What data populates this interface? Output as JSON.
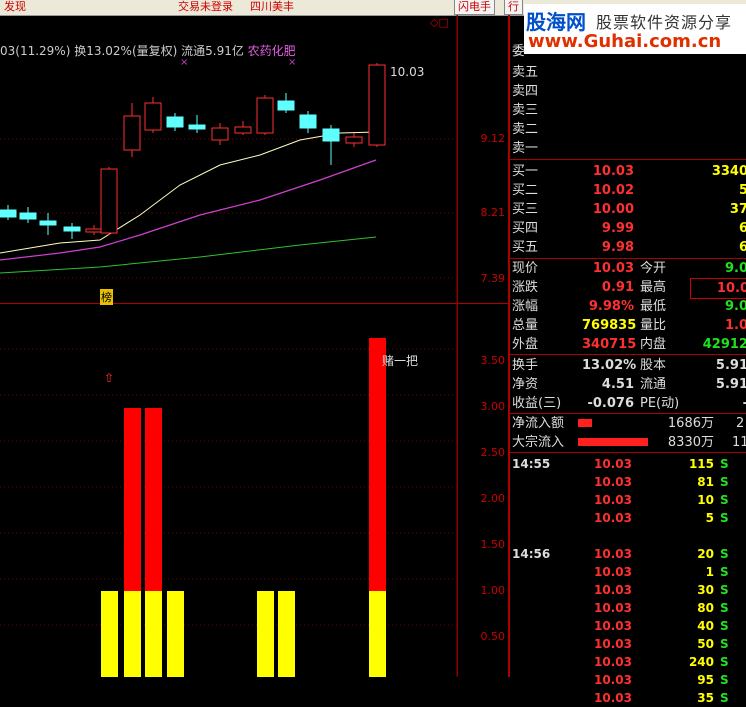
{
  "topbar": {
    "item1": "发现",
    "item2": "交易未登录",
    "item3": "四川美丰",
    "btn1": "闪电手",
    "btn2": "行"
  },
  "info": {
    "prefix": "03(11.29%) 换13.02%(量复权) 流通5.91亿 ",
    "sector": "农药化肥"
  },
  "price_axis": [
    "9.12",
    "8.21",
    "7.39"
  ],
  "price_high_label": "10.03",
  "bang_label": "榜",
  "indicator_axis": [
    "3.50",
    "3.00",
    "2.50",
    "2.00",
    "1.50",
    "1.00",
    "0.50"
  ],
  "indicator_annotation": "赌一把",
  "logo": {
    "name": "股海网",
    "slogan": "股票软件资源分享",
    "url": "www.Guhai.com.cn"
  },
  "sell_levels": [
    {
      "label": "卖五"
    },
    {
      "label": "卖四"
    },
    {
      "label": "卖三"
    },
    {
      "label": "卖二"
    },
    {
      "label": "卖一"
    }
  ],
  "sell_partial_label": "委",
  "buy_levels": [
    {
      "label": "买一",
      "price": "10.03",
      "vol": "3340"
    },
    {
      "label": "买二",
      "price": "10.02",
      "vol": "5"
    },
    {
      "label": "买三",
      "price": "10.00",
      "vol": "37"
    },
    {
      "label": "买四",
      "price": "9.99",
      "vol": "6"
    },
    {
      "label": "买五",
      "price": "9.98",
      "vol": "6"
    }
  ],
  "quote": [
    {
      "l1": "现价",
      "v1": "10.03",
      "l2": "今开",
      "v2": "9.0"
    },
    {
      "l1": "涨跌",
      "v1": "0.91",
      "l2": "最高",
      "v2": "10.0"
    },
    {
      "l1": "涨幅",
      "v1": "9.98%",
      "l2": "最低",
      "v2": "9.0"
    },
    {
      "l1": "总量",
      "v1": "769835",
      "l2": "量比",
      "v2": "1.0"
    },
    {
      "l1": "外盘",
      "v1": "340715",
      "l2": "内盘",
      "v2": "42912"
    }
  ],
  "fund": [
    {
      "l1": "换手",
      "v1": "13.02%",
      "l2": "股本",
      "v2": "5.91"
    },
    {
      "l1": "净资",
      "v1": "4.51",
      "l2": "流通",
      "v2": "5.91"
    },
    {
      "l1": "收益(三)",
      "v1": "-0.076",
      "l2": "PE(动)",
      "v2": "-"
    }
  ],
  "flow": [
    {
      "label": "净流入额",
      "value": "1686万",
      "extra": "2"
    },
    {
      "label": "大宗流入",
      "value": "8330万",
      "extra": "11"
    }
  ],
  "ticks": [
    {
      "time": "14:55",
      "price": "10.03",
      "vol": "115",
      "side": "S"
    },
    {
      "time": "",
      "price": "10.03",
      "vol": "81",
      "side": "S"
    },
    {
      "time": "",
      "price": "10.03",
      "vol": "10",
      "side": "S"
    },
    {
      "time": "",
      "price": "10.03",
      "vol": "5",
      "side": "S"
    },
    {
      "time": "14:56",
      "price": "10.03",
      "vol": "20",
      "side": "S"
    },
    {
      "time": "",
      "price": "10.03",
      "vol": "1",
      "side": "S"
    },
    {
      "time": "",
      "price": "10.03",
      "vol": "30",
      "side": "S"
    },
    {
      "time": "",
      "price": "10.03",
      "vol": "80",
      "side": "S"
    },
    {
      "time": "",
      "price": "10.03",
      "vol": "40",
      "side": "S"
    },
    {
      "time": "",
      "price": "10.03",
      "vol": "50",
      "side": "S"
    },
    {
      "time": "",
      "price": "10.03",
      "vol": "240",
      "side": "S"
    },
    {
      "time": "",
      "price": "10.03",
      "vol": "95",
      "side": "S"
    },
    {
      "time": "",
      "price": "10.03",
      "vol": "35",
      "side": "S"
    }
  ],
  "colors": {
    "up": "#ff3030",
    "down": "#20e020",
    "accent_red": "#cc0000",
    "bar_yellow": "#ffff00",
    "bar_red": "#ff0000"
  }
}
